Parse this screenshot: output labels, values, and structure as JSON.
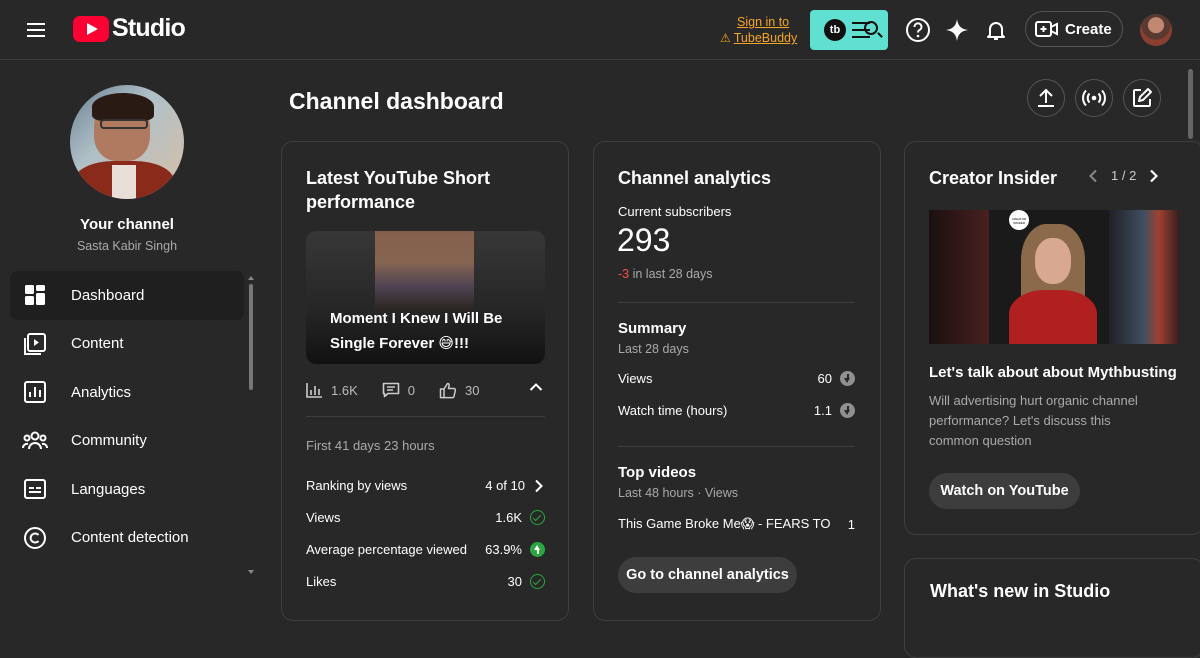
{
  "header": {
    "logo_text": "Studio",
    "tubebuddy_line1": "Sign in to",
    "tubebuddy_line2": "TubeBuddy",
    "tubebuddy_badge": "tb",
    "create_label": "Create"
  },
  "sidebar": {
    "your_channel": "Your channel",
    "channel_name": "Sasta Kabir Singh",
    "items": [
      {
        "label": "Dashboard"
      },
      {
        "label": "Content"
      },
      {
        "label": "Analytics"
      },
      {
        "label": "Community"
      },
      {
        "label": "Languages"
      },
      {
        "label": "Content detection"
      }
    ]
  },
  "main": {
    "title": "Channel dashboard"
  },
  "short_card": {
    "title": "Latest YouTube Short performance",
    "caption": "Moment I Knew I Will Be Single Forever 😅!!!",
    "views_stat": "1.6K",
    "comments_stat": "0",
    "likes_stat": "30",
    "period": "First 41 days 23 hours",
    "ranking_label": "Ranking by views",
    "ranking_value": "4 of 10",
    "views_label": "Views",
    "views_value": "1.6K",
    "avg_label": "Average percentage viewed",
    "avg_value": "63.9%",
    "likes_label": "Likes",
    "likes_value": "30"
  },
  "analytics_card": {
    "title": "Channel analytics",
    "subs_label": "Current subscribers",
    "subs_value": "293",
    "subs_change": "-3",
    "subs_change_suffix": " in last 28 days",
    "summary_title": "Summary",
    "summary_period": "Last 28 days",
    "views_label": "Views",
    "views_value": "60",
    "watch_label": "Watch time (hours)",
    "watch_value": "1.1",
    "top_title": "Top videos",
    "top_period": "Last 48 hours · Views",
    "top_video": "This Game Broke Me😱 - FEARS TO ...",
    "top_video_views": "1",
    "go_button": "Go to channel analytics"
  },
  "insider_card": {
    "title": "Creator Insider",
    "pager": "1 / 2",
    "thumb_logo": "CREATOR INSIDER",
    "video_title": "Let's talk about about Mythbusting",
    "desc": "Will advertising hurt organic channel performance? Let's discuss this common question",
    "watch_button": "Watch on YouTube"
  },
  "whats_new": {
    "title": "What's new in Studio"
  },
  "colors": {
    "accent_red": "#ff0033",
    "tubebuddy_teal": "#5fe0d1",
    "tubebuddy_orange": "#f5a623",
    "success_green": "#2ba640",
    "negative_red": "#ff4e45"
  }
}
